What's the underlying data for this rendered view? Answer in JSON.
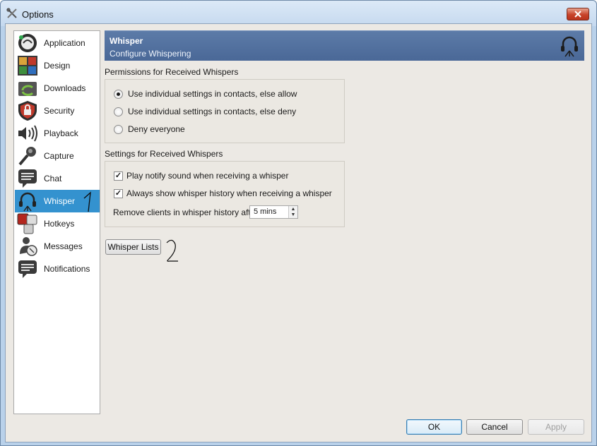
{
  "window": {
    "title": "Options"
  },
  "sidebar": {
    "items": [
      {
        "label": "Application",
        "icon": "application-icon",
        "selected": false
      },
      {
        "label": "Design",
        "icon": "design-icon",
        "selected": false
      },
      {
        "label": "Downloads",
        "icon": "downloads-icon",
        "selected": false
      },
      {
        "label": "Security",
        "icon": "security-lock-icon",
        "selected": false
      },
      {
        "label": "Playback",
        "icon": "speaker-icon",
        "selected": false
      },
      {
        "label": "Capture",
        "icon": "microphone-icon",
        "selected": false
      },
      {
        "label": "Chat",
        "icon": "chat-icon",
        "selected": false
      },
      {
        "label": "Whisper",
        "icon": "headset-icon",
        "selected": true
      },
      {
        "label": "Hotkeys",
        "icon": "hotkeys-icon",
        "selected": false
      },
      {
        "label": "Messages",
        "icon": "messages-icon",
        "selected": false
      },
      {
        "label": "Notifications",
        "icon": "notifications-icon",
        "selected": false
      }
    ]
  },
  "banner": {
    "title": "Whisper",
    "subtitle": "Configure Whispering",
    "icon": "headset-icon"
  },
  "permissions": {
    "label": "Permissions for Received Whispers",
    "options": [
      {
        "label": "Use individual settings in contacts, else allow",
        "checked": true
      },
      {
        "label": "Use individual settings in contacts, else deny",
        "checked": false
      },
      {
        "label": "Deny everyone",
        "checked": false
      }
    ]
  },
  "settings": {
    "label": "Settings for Received Whispers",
    "notify_sound": {
      "label": "Play notify sound when receiving a whisper",
      "checked": true
    },
    "show_history": {
      "label": "Always show whisper history when receiving a whisper",
      "checked": true
    },
    "remove_clients": {
      "label": "Remove clients in whisper history after",
      "value": "5 mins"
    }
  },
  "whisper_lists_button": "Whisper Lists",
  "footer": {
    "ok": "OK",
    "cancel": "Cancel",
    "apply": "Apply"
  },
  "colors": {
    "selected": "#3492cf",
    "banner": "#5c7ba8",
    "background": "#ece9e4"
  }
}
